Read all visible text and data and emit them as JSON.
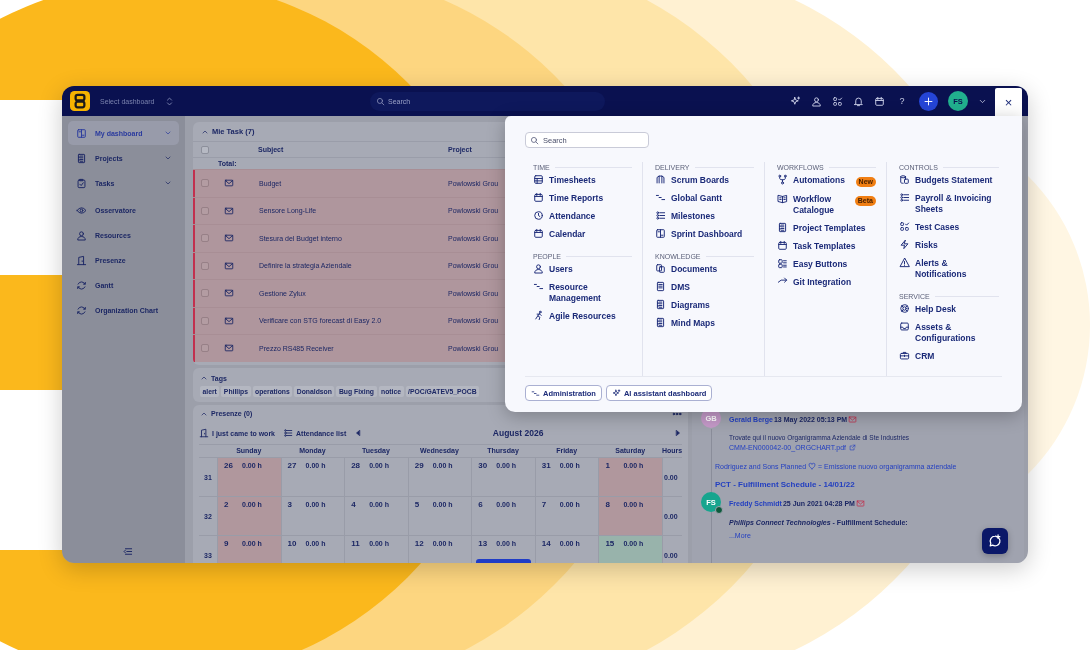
{
  "topbar": {
    "dashboard_select": "Select dashboard",
    "search": {
      "placeholder": "Search"
    },
    "help": "?",
    "avatar": "FS",
    "close": "×"
  },
  "sidebar": {
    "items": [
      {
        "label": "My dashboard",
        "selected": true,
        "expandable": true
      },
      {
        "label": "Projects",
        "selected": false,
        "expandable": true
      },
      {
        "label": "Tasks",
        "selected": false,
        "expandable": true
      },
      {
        "label": "Osservatore",
        "selected": false,
        "expandable": false
      },
      {
        "label": "Resources",
        "selected": false,
        "expandable": false
      },
      {
        "label": "Presenze",
        "selected": false,
        "expandable": false
      },
      {
        "label": "Gantt",
        "selected": false,
        "expandable": false
      },
      {
        "label": "Organization Chart",
        "selected": false,
        "expandable": false
      }
    ]
  },
  "tasks": {
    "title": "Mie Task (7)",
    "select_all_checked": false,
    "columns": [
      "Subject",
      "Project"
    ],
    "total_label": "Total:",
    "rows": [
      {
        "subject": "Budget",
        "project": "Powlowski Grou",
        "checked": false
      },
      {
        "subject": "Sensore Long-Life",
        "project": "Powlowski Grou",
        "checked": false
      },
      {
        "subject": "Stesura del Budget interno",
        "project": "Powlowski Grou",
        "checked": false
      },
      {
        "subject": "Definire la strategia Aziendale",
        "project": "Powlowski Grou",
        "checked": false
      },
      {
        "subject": "Gestione Zylux",
        "project": "Powlowski Grou",
        "checked": false
      },
      {
        "subject": "Verificare con STG forecast di Easy 2.0",
        "project": "Powlowski Grou",
        "checked": false
      },
      {
        "subject": "Prezzo RS485 Receiver",
        "project": "Powlowski Grou",
        "checked": false
      }
    ]
  },
  "tags": {
    "title": "Tags",
    "items": [
      "alert",
      "Phillips",
      "operations",
      "Donaldson",
      "Bug Fixing",
      "notice",
      "/POC/GATEV5_POCB"
    ]
  },
  "attendance": {
    "title": "Presenze (0)",
    "actions": [
      "I just came to work",
      "Attendance list"
    ],
    "month": "August 2026",
    "columns": [
      "Sunday",
      "Monday",
      "Tuesday",
      "Wednesday",
      "Thursday",
      "Friday",
      "Saturday",
      "Hours"
    ],
    "weeks": [
      {
        "week": "31",
        "total": "0.00",
        "days": [
          {
            "day": "26",
            "hours": "0.00 h",
            "kind": "weekend",
            "event": false
          },
          {
            "day": "27",
            "hours": "0.00 h",
            "kind": "workday",
            "event": false
          },
          {
            "day": "28",
            "hours": "0.00 h",
            "kind": "workday",
            "event": false
          },
          {
            "day": "29",
            "hours": "0.00 h",
            "kind": "workday",
            "event": false
          },
          {
            "day": "30",
            "hours": "0.00 h",
            "kind": "workday",
            "event": false
          },
          {
            "day": "31",
            "hours": "0.00 h",
            "kind": "workday",
            "event": false
          },
          {
            "day": "1",
            "hours": "0.00 h",
            "kind": "weekend",
            "event": false
          }
        ]
      },
      {
        "week": "32",
        "total": "0.00",
        "days": [
          {
            "day": "2",
            "hours": "0.00 h",
            "kind": "weekend",
            "event": false
          },
          {
            "day": "3",
            "hours": "0.00 h",
            "kind": "workday",
            "event": false
          },
          {
            "day": "4",
            "hours": "0.00 h",
            "kind": "workday",
            "event": false
          },
          {
            "day": "5",
            "hours": "0.00 h",
            "kind": "workday",
            "event": false
          },
          {
            "day": "6",
            "hours": "0.00 h",
            "kind": "workday",
            "event": false
          },
          {
            "day": "7",
            "hours": "0.00 h",
            "kind": "workday",
            "event": false
          },
          {
            "day": "8",
            "hours": "0.00 h",
            "kind": "weekend",
            "event": false
          }
        ]
      },
      {
        "week": "33",
        "total": "0.00",
        "days": [
          {
            "day": "9",
            "hours": "0.00 h",
            "kind": "weekend",
            "event": false
          },
          {
            "day": "10",
            "hours": "0.00 h",
            "kind": "workday",
            "event": false
          },
          {
            "day": "11",
            "hours": "0.00 h",
            "kind": "workday",
            "event": false
          },
          {
            "day": "12",
            "hours": "0.00 h",
            "kind": "workday",
            "event": false
          },
          {
            "day": "13",
            "hours": "0.00 h",
            "kind": "workday",
            "event": true
          },
          {
            "day": "14",
            "hours": "0.00 h",
            "kind": "workday",
            "event": false
          },
          {
            "day": "15",
            "hours": "0.00 h",
            "kind": "holiday",
            "event": false
          }
        ]
      }
    ]
  },
  "feed": {
    "entries": [
      {
        "avatar": "GB",
        "color": "#c59ac9",
        "online": false,
        "author": "Gerald Berge",
        "time": "13 May 2022 05:13 PM",
        "body": "Trovate qui il nuovo Organigramma Aziendale di Ste Industries",
        "attachment": "CMM-EN000042-00_ORGCHART.pdf",
        "activity": [
          "Rodriguez and Sons Planned",
          "= Emissione nuovo organigramma aziendale"
        ]
      },
      {
        "title": "PCT - Fulfillment Schedule - 14/01/22",
        "avatar": "FS",
        "color": "#17a58e",
        "online": true,
        "author": "Freddy Schmidt",
        "time": "25 Jun 2021 04:28 PM",
        "body": "*Phillips Connect Technologies* - Fulfillment Schedule:",
        "more": "...More"
      }
    ]
  },
  "menu": {
    "search": {
      "placeholder": "Search"
    },
    "columns": [
      [
        {
          "heading": "TIME",
          "items": [
            {
              "label": "Timesheets"
            },
            {
              "label": "Time Reports"
            },
            {
              "label": "Attendance"
            },
            {
              "label": "Calendar"
            }
          ]
        },
        {
          "heading": "PEOPLE",
          "items": [
            {
              "label": "Users"
            },
            {
              "label": "Resource Management"
            },
            {
              "label": "Agile Resources"
            }
          ]
        }
      ],
      [
        {
          "heading": "DELIVERY",
          "items": [
            {
              "label": "Scrum Boards"
            },
            {
              "label": "Global Gantt"
            },
            {
              "label": "Milestones"
            },
            {
              "label": "Sprint Dashboard"
            }
          ]
        },
        {
          "heading": "KNOWLEDGE",
          "items": [
            {
              "label": "Documents"
            },
            {
              "label": "DMS"
            },
            {
              "label": "Diagrams"
            },
            {
              "label": "Mind Maps"
            }
          ]
        }
      ],
      [
        {
          "heading": "WORKFLOWS",
          "items": [
            {
              "label": "Automations",
              "badge": "New"
            },
            {
              "label": "Workflow Catalogue",
              "badge": "Beta"
            },
            {
              "label": "Project Templates"
            },
            {
              "label": "Task Templates"
            },
            {
              "label": "Easy Buttons"
            },
            {
              "label": "Git Integration"
            }
          ]
        }
      ],
      [
        {
          "heading": "CONTROLS",
          "items": [
            {
              "label": "Budgets Statement"
            },
            {
              "label": "Payroll & Invoicing Sheets"
            },
            {
              "label": "Test Cases"
            },
            {
              "label": "Risks"
            },
            {
              "label": "Alerts & Notifications"
            }
          ]
        },
        {
          "heading": "SERVICE",
          "items": [
            {
              "label": "Help Desk"
            },
            {
              "label": "Assets & Configurations"
            },
            {
              "label": "CRM"
            }
          ]
        }
      ]
    ],
    "footer": [
      "Administration",
      "AI assistant dashboard"
    ]
  }
}
